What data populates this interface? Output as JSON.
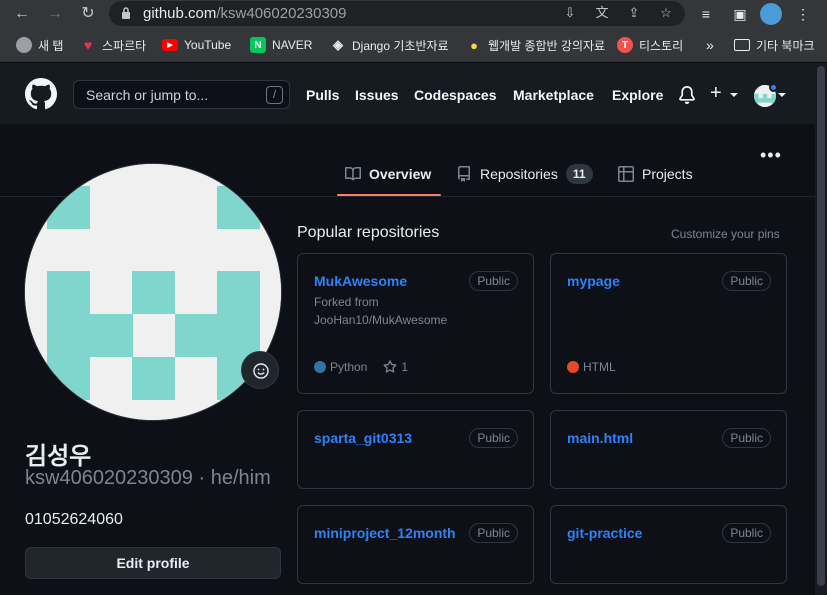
{
  "browser": {
    "url_host": "github.com",
    "url_path": "/ksw406020230309",
    "bookmarks": [
      {
        "label": "새 탭",
        "icon": "globe-icon",
        "color": "#9aa0a6"
      },
      {
        "label": "스파르타",
        "icon": "heart-icon",
        "color": "#e8344e"
      },
      {
        "label": "YouTube",
        "icon": "youtube-icon",
        "color": "#ff0000"
      },
      {
        "label": "NAVER",
        "icon": "naver-icon",
        "color": "#03c75a"
      },
      {
        "label": "Django 기초반자료",
        "icon": "tag-icon",
        "color": "#e8eaed"
      },
      {
        "label": "웹개발 종합반 강의자료",
        "icon": "bulb-icon",
        "color": "#f7d148"
      },
      {
        "label": "티스토리",
        "icon": "tistory-icon",
        "color": "#f0544f"
      },
      {
        "label": "»",
        "icon": "more-bookmarks-icon",
        "color": "#e8eaed"
      },
      {
        "label": "기타 북마크",
        "icon": "folder-icon",
        "color": "#e8eaed"
      }
    ]
  },
  "header": {
    "search_placeholder": "Search or jump to...",
    "search_shortcut": "/",
    "nav": [
      "Pulls",
      "Issues",
      "Codespaces",
      "Marketplace",
      "Explore"
    ],
    "plus": "+"
  },
  "tabs": [
    {
      "label": "Overview",
      "icon": "book-icon",
      "active": true
    },
    {
      "label": "Repositories",
      "icon": "repo-icon",
      "count": "11"
    },
    {
      "label": "Projects",
      "icon": "table-icon"
    }
  ],
  "profile": {
    "name": "김성우",
    "login": "ksw406020230309 · he/him",
    "phone": "01052624060",
    "edit_label": "Edit profile"
  },
  "pinned": {
    "title": "Popular repositories",
    "customize": "Customize your pins",
    "repos": [
      {
        "name": "MukAwesome",
        "visibility": "Public",
        "fork_line1": "Forked from",
        "fork_line2": "JooHan10/MukAwesome",
        "language": "Python",
        "lang_color": "#3572A5",
        "stars": "1"
      },
      {
        "name": "mypage",
        "visibility": "Public",
        "language": "HTML",
        "lang_color": "#e34c26"
      },
      {
        "name": "sparta_git0313",
        "visibility": "Public"
      },
      {
        "name": "main.html",
        "visibility": "Public"
      },
      {
        "name": "miniproject_12month",
        "visibility": "Public"
      },
      {
        "name": "git-practice",
        "visibility": "Public"
      }
    ]
  },
  "colors": {
    "accent": "#2f81f7",
    "tab_underline": "#f78166",
    "identicon": "#7fd6cd"
  }
}
